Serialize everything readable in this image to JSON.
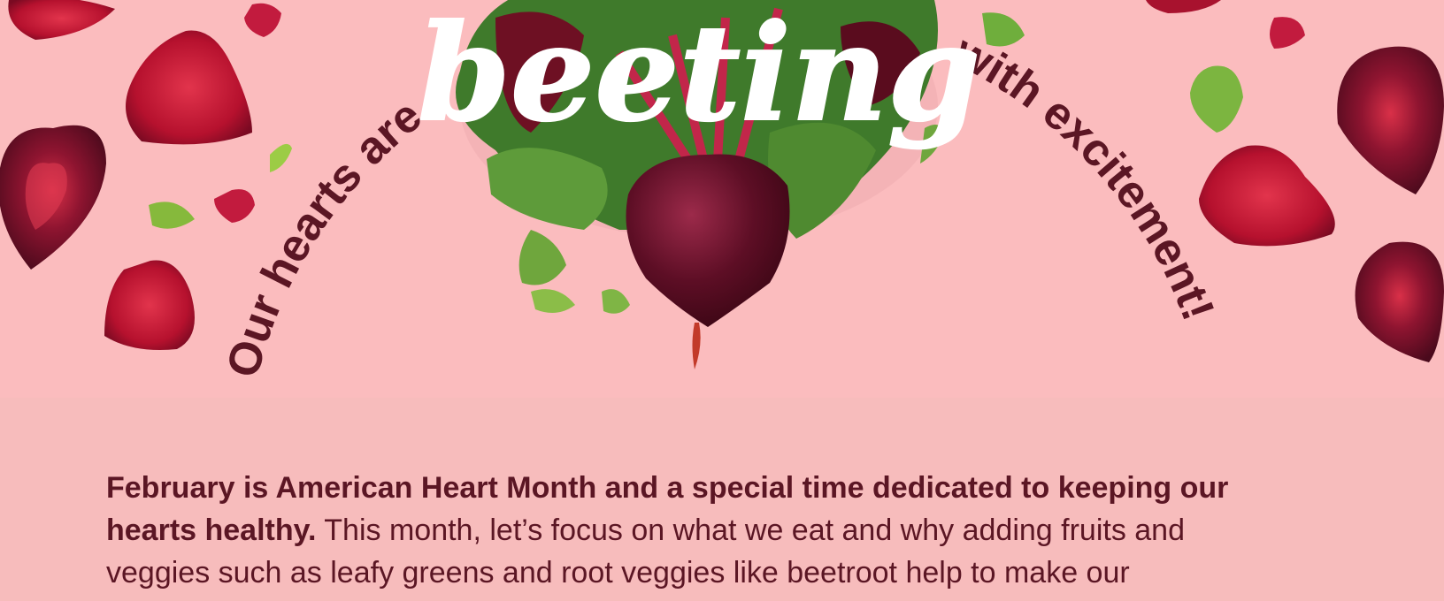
{
  "hero": {
    "arc_left": "Our hearts are",
    "script_word": "beeting",
    "arc_right": "with excitement!"
  },
  "intro": {
    "bold": "February is American Heart Month and a special time dedicated to keeping our hearts healthy.",
    "text": " This month, let’s focus on what we eat and why adding fruits and veggies such as leafy greens and root veggies like beetroot help to make our"
  },
  "colors": {
    "hero_bg": "#fbbcbe",
    "body_bg": "#f7bcbc",
    "text": "#5b1624",
    "beet": "#8e1430",
    "leaf": "#5e9b3a"
  }
}
